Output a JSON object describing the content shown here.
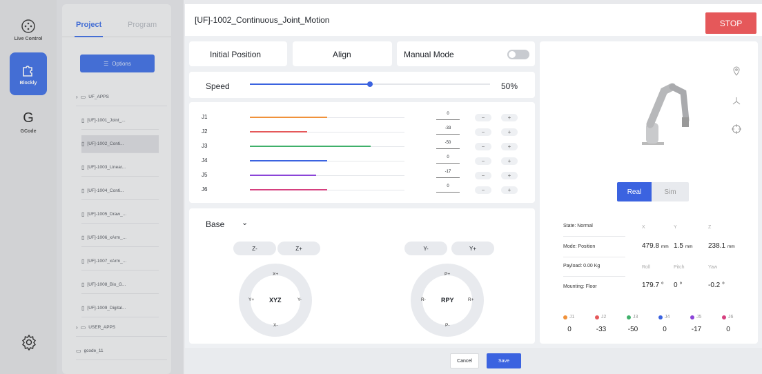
{
  "nav": {
    "items": [
      {
        "label": "Live Control"
      },
      {
        "label": "Blockly"
      },
      {
        "label": "GCode"
      }
    ]
  },
  "tree": {
    "tabs": [
      "Project",
      "Program"
    ],
    "options_label": "Options",
    "items": [
      {
        "label": "UF_APPS"
      },
      {
        "label": "[UF]-1001_Joint_..."
      },
      {
        "label": "[UF]-1002_Conti..."
      },
      {
        "label": "[UF]-1003_Linear..."
      },
      {
        "label": "[UF]-1004_Conti..."
      },
      {
        "label": "[UF]-1005_Draw_..."
      },
      {
        "label": "[UF]-1006_xArm_..."
      },
      {
        "label": "[UF]-1007_xArm_..."
      },
      {
        "label": "[UF]-1008_Bio_G..."
      },
      {
        "label": "[UF]-1009_Digital..."
      },
      {
        "label": "USER_APPS"
      },
      {
        "label": "gcode_11"
      }
    ]
  },
  "header": {
    "title": "[UF]-1002_Continuous_Joint_Motion",
    "stop_label": "STOP"
  },
  "controls": {
    "initial_position": "Initial Position",
    "align": "Align",
    "manual_mode": "Manual Mode",
    "manual_mode_on": false
  },
  "speed": {
    "label": "Speed",
    "value": 50,
    "value_text": "50%"
  },
  "joints": [
    {
      "label": "J1",
      "value": "0",
      "fill": 0.5,
      "color": "#f0913a"
    },
    {
      "label": "J2",
      "value": "-33",
      "fill": 0.37,
      "color": "#e5585a"
    },
    {
      "label": "J3",
      "value": "-50",
      "fill": 0.78,
      "color": "#3fb06a"
    },
    {
      "label": "J4",
      "value": "0",
      "fill": 0.5,
      "color": "#3b63e0"
    },
    {
      "label": "J5",
      "value": "-17",
      "fill": 0.43,
      "color": "#8b44d8"
    },
    {
      "label": "J6",
      "value": "0",
      "fill": 0.5,
      "color": "#d6407f"
    }
  ],
  "jog": {
    "frame": "Base",
    "z_minus": "Z-",
    "z_plus": "Z+",
    "y_minus": "Y-",
    "y_plus": "Y+",
    "xyz": {
      "center": "XYZ",
      "top": "X+",
      "bottom": "X-",
      "left": "Y+",
      "right": "Y-"
    },
    "rpy": {
      "center": "RPY",
      "top": "P+",
      "bottom": "P-",
      "left": "R-",
      "right": "R+"
    }
  },
  "footer": {
    "cancel": "Cancel",
    "save": "Save"
  },
  "mode_toggle": {
    "real": "Real",
    "sim": "Sim"
  },
  "status": {
    "state": "State: Normal",
    "mode": "Mode: Position",
    "payload": "Payload: 0.00 Kg",
    "mounting": "Mounting: Floor",
    "x_label": "X",
    "y_label": "Y",
    "z_label": "Z",
    "x": "479.8",
    "y": "1.5",
    "z": "238.1",
    "unit": "mm",
    "roll_label": "Roll",
    "pitch_label": "Pitch",
    "yaw_label": "Yaw",
    "roll": "179.7 °",
    "pitch": "0 °",
    "yaw": "-0.2 °"
  },
  "joint_readout": [
    {
      "label": "J1",
      "value": "0",
      "color": "#f0913a"
    },
    {
      "label": "J2",
      "value": "-33",
      "color": "#e5585a"
    },
    {
      "label": "J3",
      "value": "-50",
      "color": "#3fb06a"
    },
    {
      "label": "J4",
      "value": "0",
      "color": "#3b63e0"
    },
    {
      "label": "J5",
      "value": "-17",
      "color": "#8b44d8"
    },
    {
      "label": "J6",
      "value": "0",
      "color": "#d6407f"
    }
  ]
}
